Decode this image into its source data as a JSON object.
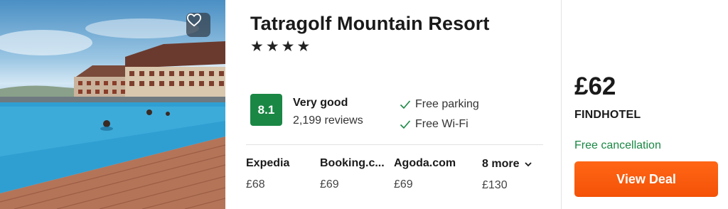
{
  "hotel": {
    "name": "Tatragolf Mountain Resort",
    "stars": 4,
    "stars_text": "★★★★",
    "rating_score": "8.1",
    "rating_label": "Very good",
    "reviews": "2,199 reviews",
    "amenities": [
      "Free parking",
      "Free Wi-Fi"
    ],
    "photo_icon": "favorite-heart-icon"
  },
  "providers": [
    {
      "name": "Expedia",
      "price": "£68"
    },
    {
      "name": "Booking.c...",
      "price": "£69"
    },
    {
      "name": "Agoda.com",
      "price": "£69"
    }
  ],
  "more": {
    "label": "8 more",
    "price": "£130"
  },
  "deal": {
    "price": "£62",
    "partner": "FINDHOTEL",
    "cancellation": "Free cancellation",
    "button": "View Deal"
  },
  "colors": {
    "rating_green": "#1a8744",
    "cta_orange": "#ff5a0a",
    "cancel_green": "#1a8744"
  }
}
